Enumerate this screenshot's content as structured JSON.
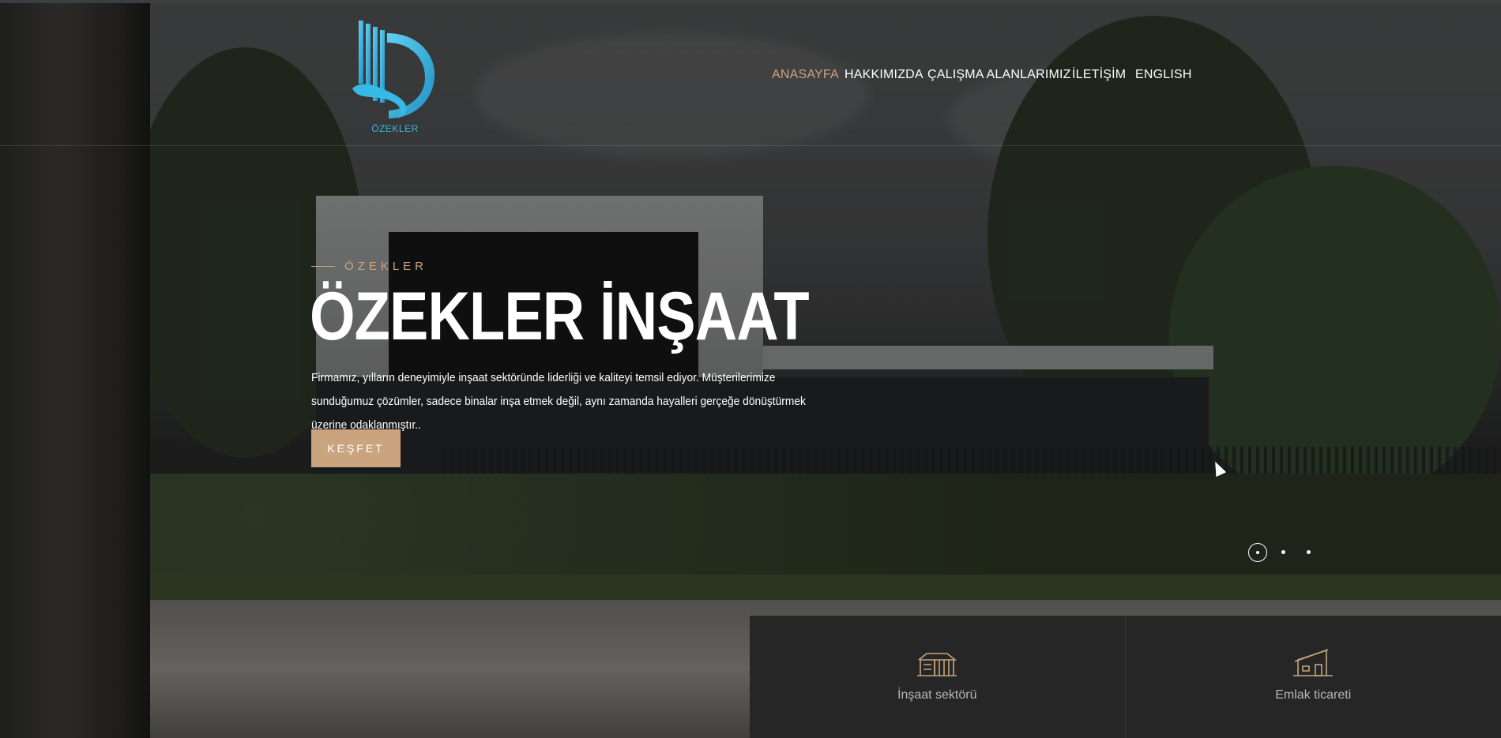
{
  "brand": {
    "logo_text": "ÖZEKLER",
    "logo_color": "#3fb4df"
  },
  "nav": {
    "items": [
      {
        "label": "ANASAYFA",
        "active": true
      },
      {
        "label": "HAKKIMIZDA",
        "active": false
      },
      {
        "label": "ÇALIŞMA ALANLARIMIZ",
        "active": false
      },
      {
        "label": "İLETİŞİM",
        "active": false
      },
      {
        "label": "ENGLISH",
        "active": false
      }
    ],
    "active_color": "#c9a47e"
  },
  "hero": {
    "eyebrow": "ÖZEKLER",
    "title": "ÖZEKLER İNŞAAT",
    "description": "Firmamız, yılların deneyimiyle inşaat sektöründe liderliği ve kaliteyi temsil ediyor. Müşterilerimize sunduğumuz çözümler, sadece binalar inşa etmek değil, aynı zamanda hayalleri gerçeğe dönüştürmek üzerine odaklanmıştır..",
    "button_label": "KEŞFET",
    "accent_color": "#c9a47e"
  },
  "slider": {
    "slide_count": 3,
    "active_index": 0
  },
  "cards": [
    {
      "label": "İnşaat sektörü",
      "icon": "building-icon"
    },
    {
      "label": "Emlak ticareti",
      "icon": "house-icon"
    }
  ]
}
